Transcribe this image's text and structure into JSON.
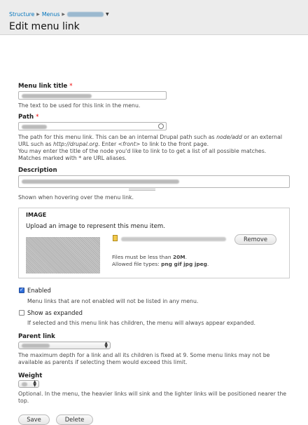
{
  "breadcrumb": {
    "items": [
      "Structure",
      "Menus"
    ]
  },
  "page": {
    "title": "Edit menu link"
  },
  "fields": {
    "menu_link_title": {
      "label": "Menu link title",
      "required_mark": "*",
      "description": "The text to be used for this link in the menu."
    },
    "path": {
      "label": "Path",
      "required_mark": "*",
      "desc_line1_a": "The path for this menu link. This can be an internal Drupal path such as ",
      "desc_line1_em": "node/add",
      "desc_line1_b": " or an external",
      "desc_line2_a": "URL such as ",
      "desc_line2_em1": "http://drupal.org",
      "desc_line2_b": ". Enter ",
      "desc_line2_em2": "<front>",
      "desc_line2_c": " to link to the front page.",
      "desc_line3": "You may enter the title of the node you'd like to link to to get a list of all possible matches.",
      "desc_line4": "Matches marked with * are URL aliases."
    },
    "description": {
      "label": "Description",
      "help": "Shown when hovering over the menu link."
    },
    "image": {
      "legend": "IMAGE",
      "help": "Upload an image to represent this menu item.",
      "remove_label": "Remove",
      "size_note_prefix": "Files must be less than ",
      "size_note_value": "20M",
      "size_note_suffix": ".",
      "types_note_prefix": "Allowed file types: ",
      "types_note_value": "png gif jpg jpeg",
      "types_note_suffix": "."
    },
    "enabled": {
      "label": "Enabled",
      "checked": true,
      "description": "Menu links that are not enabled will not be listed in any menu."
    },
    "show_expanded": {
      "label": "Show as expanded",
      "checked": false,
      "description": "If selected and this menu link has children, the menu will always appear expanded."
    },
    "parent_link": {
      "label": "Parent link",
      "desc_line1": "The maximum depth for a link and all its children is fixed at 9. Some menu links may not be",
      "desc_line2": "available as parents if selecting them would exceed this limit."
    },
    "weight": {
      "label": "Weight",
      "desc_line1": "Optional. In the menu, the heavier links will sink and the lighter links will be positioned nearer the",
      "desc_line2": "top."
    }
  },
  "actions": {
    "save_label": "Save",
    "delete_label": "Delete"
  },
  "icons": {
    "breadcrumb_separator": "triangle-right-icon",
    "breadcrumb_dropdown": "caret-down-icon",
    "autocomplete": "autocomplete-throbber-icon",
    "file": "file-image-icon",
    "select": "select-arrows-icon"
  },
  "colors": {
    "link": "#0074bd",
    "required": "#ee0000",
    "checkbox_checked": "#2f6fdc"
  }
}
